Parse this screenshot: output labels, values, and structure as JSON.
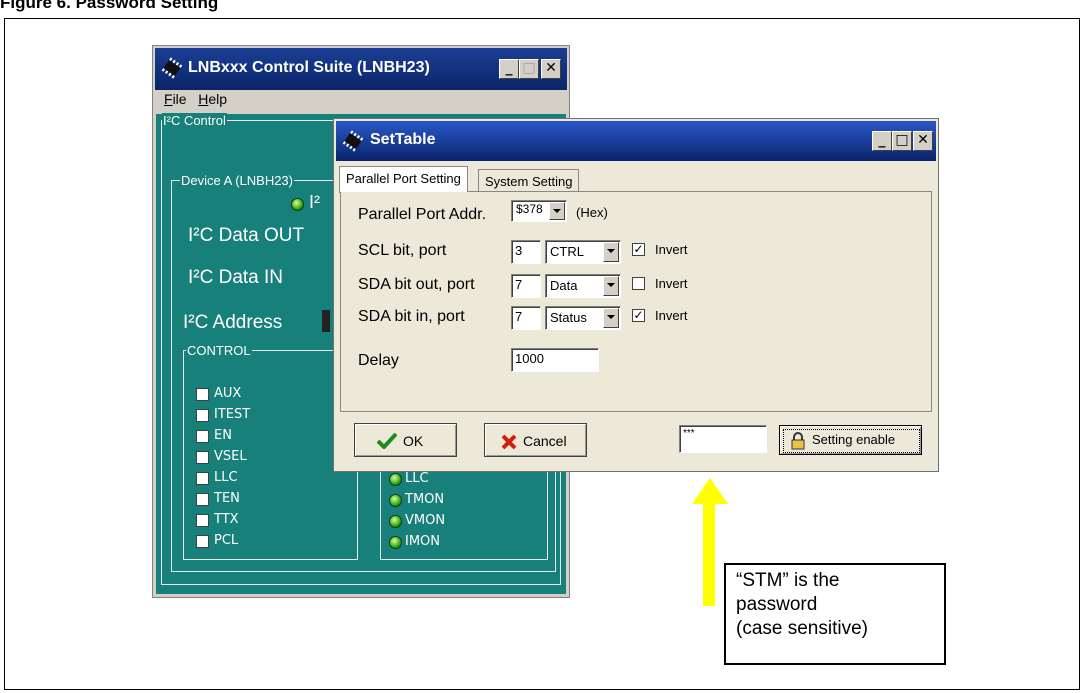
{
  "figure": {
    "title": "Figure 6. Password Setting"
  },
  "main_window": {
    "title": "LNBxxx Control Suite  (LNBH23)",
    "controls": {
      "minimize": "_",
      "maximize": "□",
      "close": "✕"
    },
    "menu": [
      {
        "first": "F",
        "rest": "ile"
      },
      {
        "first": "H",
        "rest": "elp"
      }
    ],
    "i2c_group": "I²C Control",
    "device_group": "Device A (LNBH23)",
    "i2c_partial": "I²",
    "data_out": "I²C Data  OUT",
    "data_in": "I²C Data IN",
    "address": "I²C Address",
    "control_group": "CONTROL",
    "control_items": [
      "AUX",
      "ITEST",
      "EN",
      "VSEL",
      "LLC",
      "TEN",
      "TTX",
      "PCL"
    ],
    "status_items": [
      "LLC",
      "TMON",
      "VMON",
      "IMON"
    ]
  },
  "dialog": {
    "title": "SetTable",
    "controls": {
      "minimize": "_",
      "maximize": "□",
      "close": "✕"
    },
    "tabs": [
      "Parallel Port Setting",
      "System Setting"
    ],
    "parallel_port_label": "Parallel Port Addr.",
    "parallel_port_value": "$378",
    "hex_label": "(Hex)",
    "rows": [
      {
        "label": "SCL bit, port",
        "bit": "3",
        "port": "CTRL",
        "invert_checked": true,
        "check": "✓",
        "invert": "Invert"
      },
      {
        "label": "SDA bit out, port",
        "bit": "7",
        "port": "Data",
        "invert_checked": false,
        "check": "",
        "invert": "Invert"
      },
      {
        "label": "SDA bit in, port",
        "bit": "7",
        "port": "Status",
        "invert_checked": true,
        "check": "✓",
        "invert": "Invert"
      }
    ],
    "delay_label": "Delay",
    "delay_value": "1000",
    "ok_label": "OK",
    "cancel_label": "Cancel",
    "password_value": "***",
    "setting_enable_label": "Setting enable"
  },
  "annotation": {
    "lines": [
      "“STM” is the",
      "password",
      "(case sensitive)"
    ],
    "arrow_color": "#ffff00"
  }
}
